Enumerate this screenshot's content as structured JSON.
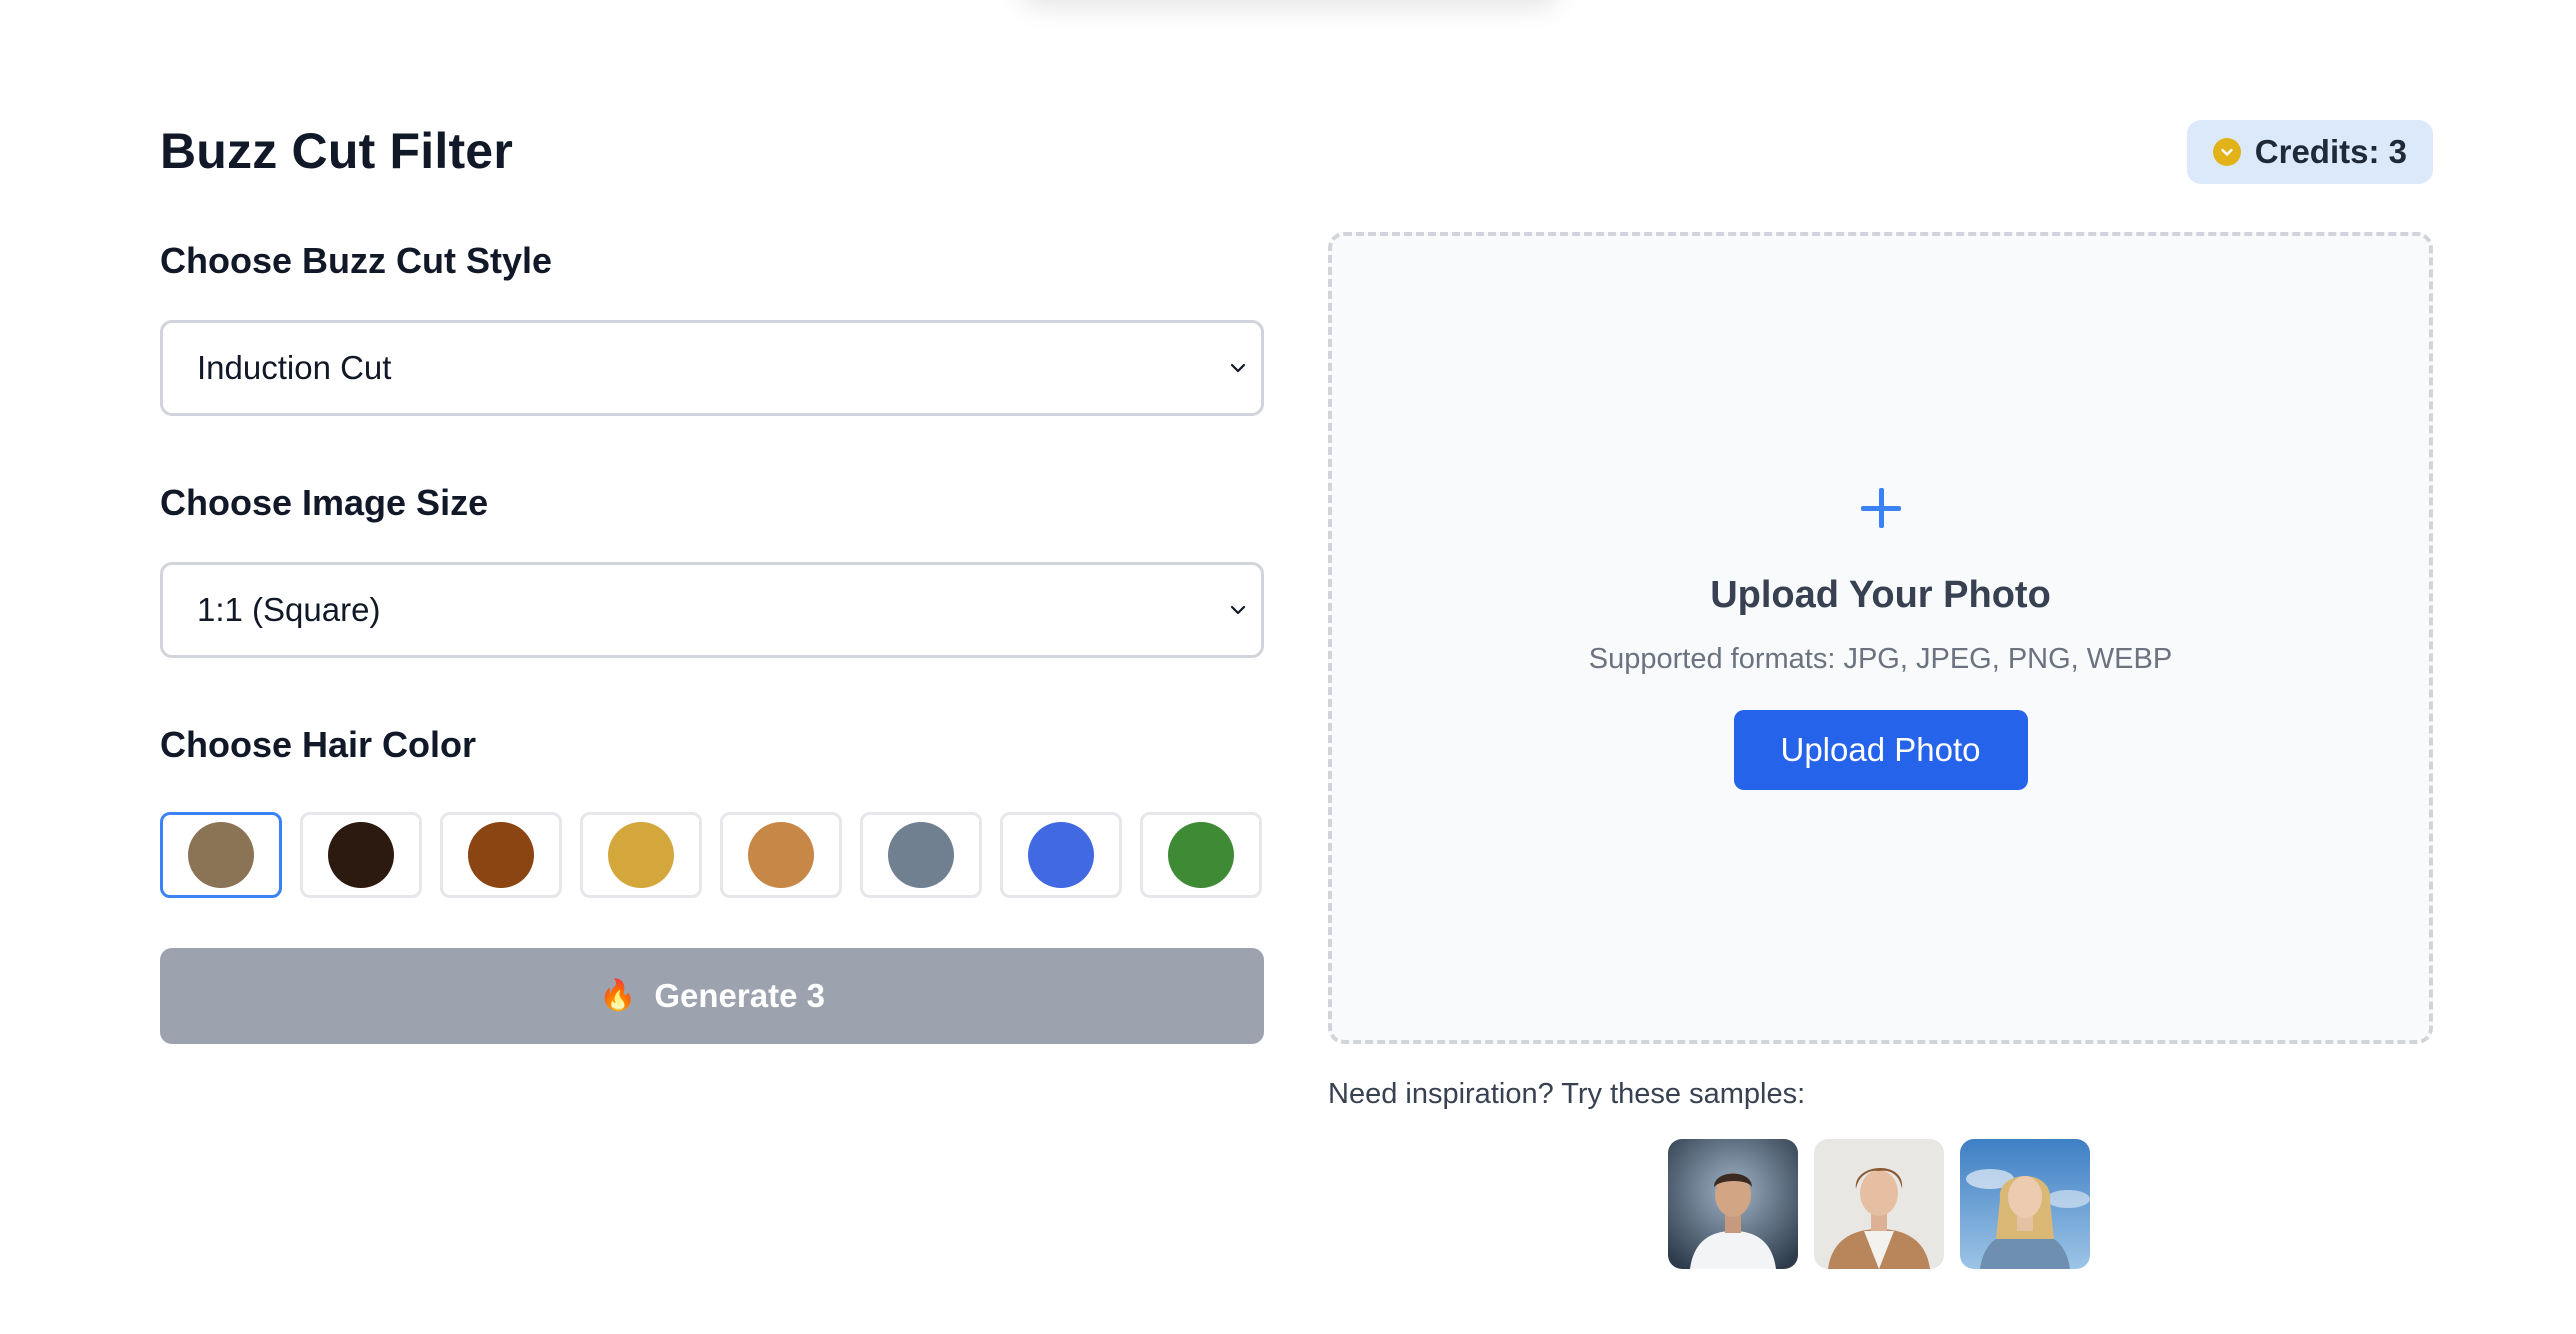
{
  "page": {
    "title": "Buzz Cut Filter"
  },
  "credits": {
    "label": "Credits: 3",
    "icon": "coin-check-icon",
    "color": "#e2b319"
  },
  "style_section": {
    "label": "Choose Buzz Cut Style",
    "selected": "Induction Cut"
  },
  "size_section": {
    "label": "Choose Image Size",
    "selected": "1:1 (Square)"
  },
  "color_section": {
    "label": "Choose Hair Color",
    "swatches": [
      {
        "name": "hair-color-swatch-1",
        "color": "#8b7355",
        "selected": true
      },
      {
        "name": "hair-color-swatch-2",
        "color": "#2c1a10",
        "selected": false
      },
      {
        "name": "hair-color-swatch-3",
        "color": "#8b4513",
        "selected": false
      },
      {
        "name": "hair-color-swatch-4",
        "color": "#d4a73c",
        "selected": false
      },
      {
        "name": "hair-color-swatch-5",
        "color": "#c68747",
        "selected": false
      },
      {
        "name": "hair-color-swatch-6",
        "color": "#708090",
        "selected": false
      },
      {
        "name": "hair-color-swatch-7",
        "color": "#4169e1",
        "selected": false
      },
      {
        "name": "hair-color-swatch-8",
        "color": "#3f8a35",
        "selected": false
      }
    ]
  },
  "generate": {
    "icon": "🔥",
    "label": "Generate 3"
  },
  "upload": {
    "icon": "plus-icon",
    "title": "Upload Your Photo",
    "formats": "Supported formats: JPG, JPEG, PNG, WEBP",
    "button_label": "Upload Photo"
  },
  "samples": {
    "label": "Need inspiration? Try these samples:",
    "items": [
      {
        "name": "sample-photo-1"
      },
      {
        "name": "sample-photo-2"
      },
      {
        "name": "sample-photo-3"
      }
    ]
  },
  "colors": {
    "primary": "#2563eb",
    "accent": "#3b82f6",
    "disabled": "#9ca3af",
    "badge_bg": "#dce9fb"
  }
}
